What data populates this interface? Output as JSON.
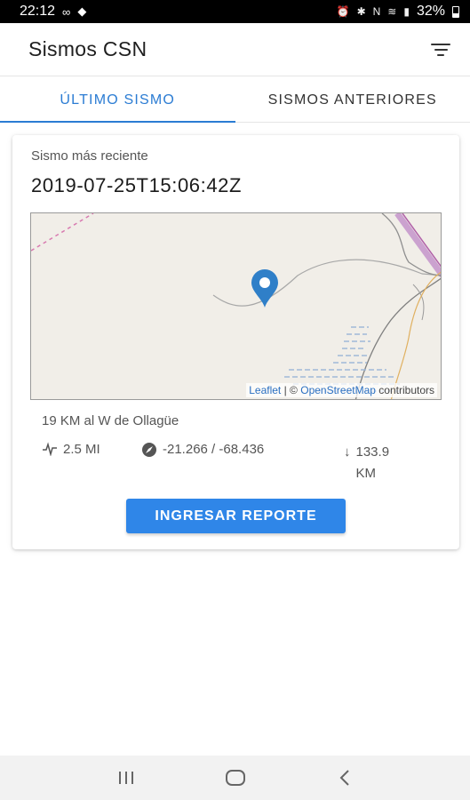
{
  "status_bar": {
    "time": "22:12",
    "battery": "32%"
  },
  "app_bar": {
    "title": "Sismos CSN",
    "filter_icon": "filter-icon"
  },
  "tabs": [
    {
      "label": "ÚLTIMO SISMO",
      "active": true
    },
    {
      "label": "SISMOS ANTERIORES",
      "active": false
    }
  ],
  "card": {
    "subtitle": "Sismo más reciente",
    "datetime": "2019-07-25T15:06:42Z",
    "map": {
      "attribution_leaflet": "Leaflet",
      "attribution_sep": "| ©",
      "attribution_osm": "OpenStreetMap",
      "attribution_suffix": "contributors",
      "marker_icon": "map-marker-icon"
    },
    "location": "19 KM al W de Ollagüe",
    "magnitude": "2.5 MI",
    "coordinates": "-21.266 / -68.436",
    "depth": "133.9 KM",
    "report_button": "INGRESAR REPORTE"
  },
  "colors": {
    "accent": "#2b7cd3",
    "button": "#2f86e8",
    "marker": "#2f7fc8",
    "map_background": "#f1eee8"
  }
}
